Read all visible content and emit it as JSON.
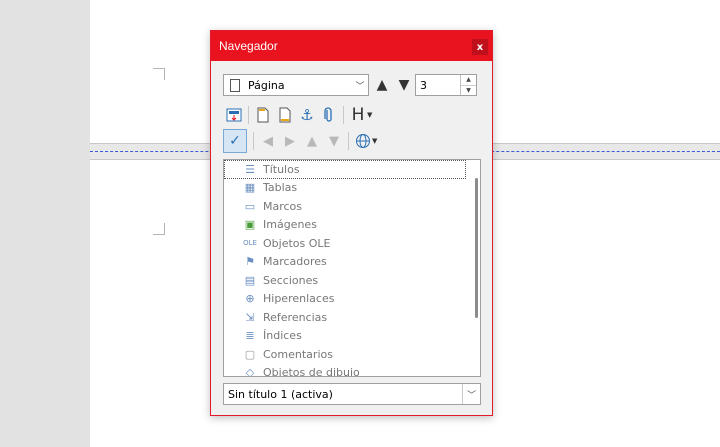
{
  "dialog": {
    "title": "Navegador",
    "close_label": "x"
  },
  "toolbar": {
    "category_select": {
      "value": "Página"
    },
    "up_arrow": "▲",
    "down_arrow": "▼",
    "page_number": "3",
    "heading_label": "H",
    "colors": {
      "accent": "#e8131f",
      "check": "#2a6fb5"
    }
  },
  "tree": {
    "items": [
      {
        "label": "Títulos",
        "icon": "headings-icon"
      },
      {
        "label": "Tablas",
        "icon": "table-icon"
      },
      {
        "label": "Marcos",
        "icon": "frame-icon"
      },
      {
        "label": "Imágenes",
        "icon": "image-icon"
      },
      {
        "label": "Objetos OLE",
        "icon": "ole-icon"
      },
      {
        "label": "Marcadores",
        "icon": "bookmark-icon"
      },
      {
        "label": "Secciones",
        "icon": "section-icon"
      },
      {
        "label": "Hiperenlaces",
        "icon": "hyperlink-icon"
      },
      {
        "label": "Referencias",
        "icon": "reference-icon"
      },
      {
        "label": "Índices",
        "icon": "index-icon"
      },
      {
        "label": "Comentarios",
        "icon": "comment-icon"
      },
      {
        "label": "Objetos de dibujo",
        "icon": "drawing-icon"
      }
    ]
  },
  "document_select": {
    "value": "Sin título 1 (activa)"
  }
}
